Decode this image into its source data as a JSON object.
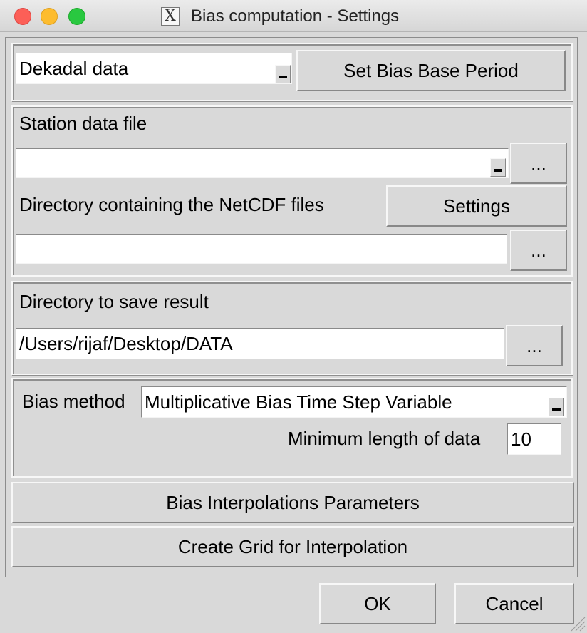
{
  "window": {
    "title": "Bias computation - Settings",
    "app_icon": "x11-icon"
  },
  "data_type": {
    "selected": "Dekadal data",
    "base_period_button": "Set Bias Base Period"
  },
  "station": {
    "label": "Station data file",
    "value": "",
    "browse_button": "..."
  },
  "netcdf": {
    "label": "Directory containing the NetCDF files",
    "settings_button": "Settings",
    "value": "",
    "browse_button": "..."
  },
  "save": {
    "label": "Directory to save result",
    "value": "/Users/rijaf/Desktop/DATA",
    "browse_button": "..."
  },
  "bias": {
    "method_label": "Bias method",
    "method_value": "Multiplicative Bias Time Step Variable",
    "min_length_label": "Minimum length of data",
    "min_length_value": "10"
  },
  "buttons": {
    "interp_params": "Bias Interpolations Parameters",
    "create_grid": "Create Grid for Interpolation",
    "ok": "OK",
    "cancel": "Cancel"
  }
}
